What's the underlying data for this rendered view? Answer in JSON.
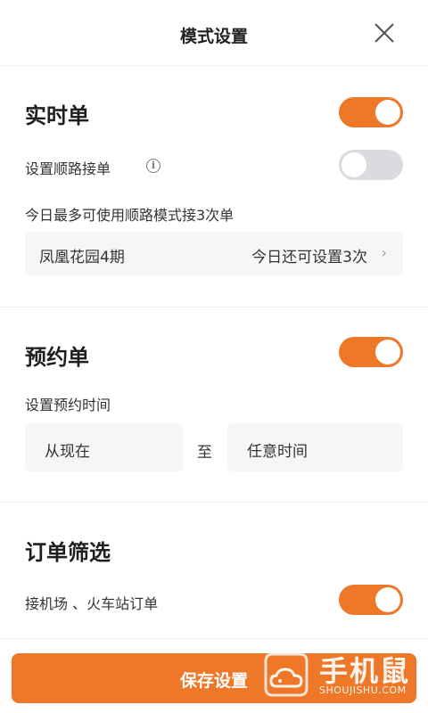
{
  "header": {
    "title": "模式设置"
  },
  "realtime": {
    "title": "实时单",
    "enabled": true,
    "route_label": "设置顺路接单",
    "route_enabled": false,
    "limit_text": "今日最多可使用顺路模式接3次单",
    "location": "凤凰花园4期",
    "remaining": "今日还可设置3次"
  },
  "reserve": {
    "title": "预约单",
    "enabled": true,
    "time_label": "设置预约时间",
    "from": "从现在",
    "to_sep": "至",
    "to": "任意时间"
  },
  "filter": {
    "title": "订单筛选",
    "airport_label": "接机场 、火车站订单",
    "airport_enabled": true
  },
  "footer": {
    "save_label": "保存设置"
  },
  "watermark": {
    "brand": "手机鼠",
    "domain": "SHOUJISHU.COM"
  },
  "colors": {
    "accent": "#ee7728",
    "toggle_off": "#d9dbe0"
  }
}
